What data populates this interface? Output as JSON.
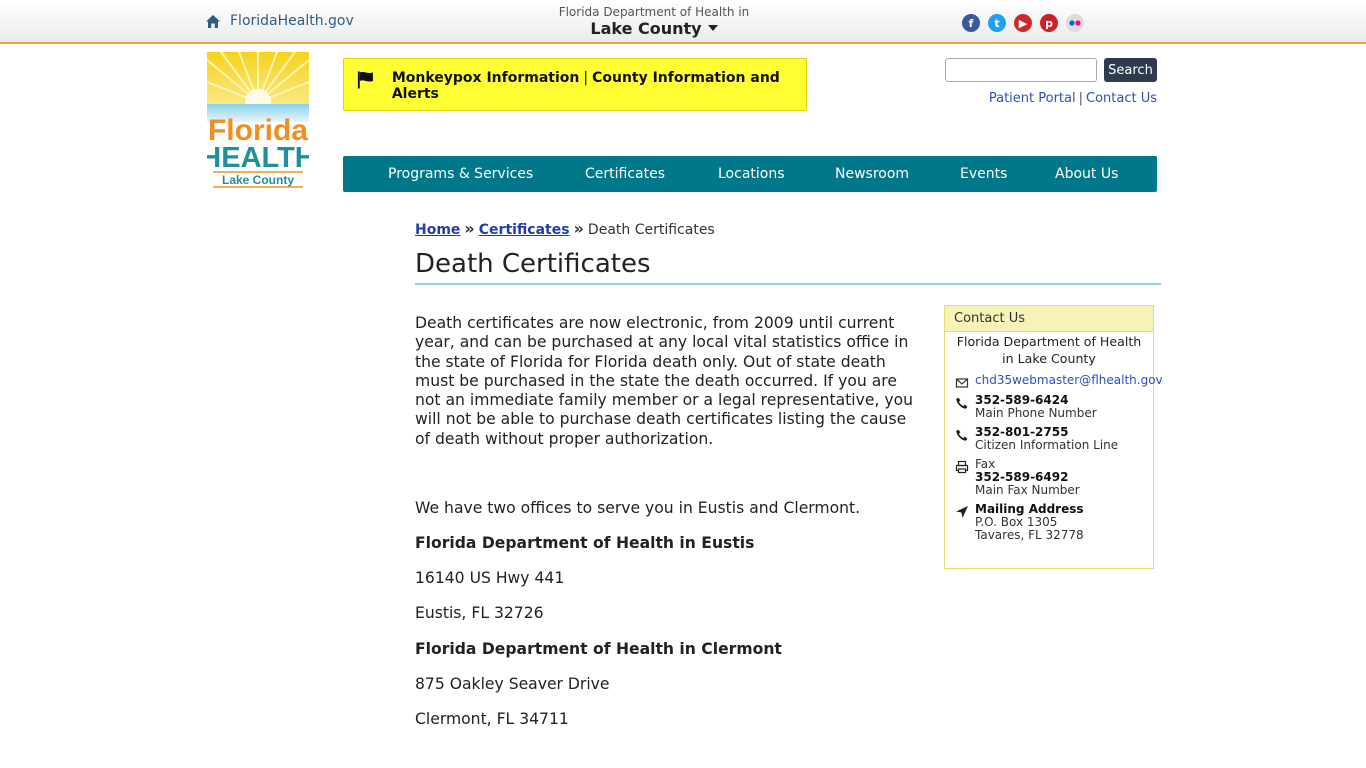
{
  "topbar": {
    "home_link": "FloridaHealth.gov",
    "dept_line": "Florida Department of Health in",
    "county": "Lake County",
    "social_icons": [
      "facebook-icon",
      "twitter-icon",
      "youtube-icon",
      "pinterest-icon",
      "flickr-icon"
    ]
  },
  "logo": {
    "word1": "Florida",
    "word2": "HEALTH",
    "county": "Lake County"
  },
  "alert": {
    "link1": "Monkeypox Information",
    "separator": "|",
    "link2": "County Information and Alerts"
  },
  "search": {
    "placeholder": "",
    "button": "Search"
  },
  "util_links": {
    "patient_portal": "Patient Portal",
    "separator": "|",
    "contact_us": "Contact Us"
  },
  "nav": {
    "items": [
      "Programs & Services",
      "Certificates",
      "Locations",
      "Newsroom",
      "Events",
      "About Us"
    ]
  },
  "breadcrumb": {
    "home": "Home",
    "separator": "»",
    "certificates": "Certificates",
    "current": "Death Certificates"
  },
  "page_title": "Death Certificates",
  "content": {
    "intro": "Death certificates are now electronic, from 2009 until current year, and can be purchased at any local vital statistics office in the state of Florida for Florida death only.  Out of state death must be purchased in the state the death occurred. If you are not an immediate family member or a legal representative, you will not be able to purchase death certificates listing the cause of death without proper authorization.",
    "offices_intro": "We have two offices to serve you in Eustis and Clermont.",
    "office1_name": "Florida Department of Health in Eustis",
    "office1_street": "16140 US Hwy 441",
    "office1_city": "Eustis, FL 32726",
    "office2_name": "Florida Department of Health in Clermont",
    "office2_street": "875 Oakley Seaver Drive",
    "office2_city": "Clermont, FL 34711"
  },
  "sidebar": {
    "heading": "Contact Us",
    "org": "Florida Department of Health in Lake County",
    "email": "chd35webmaster@flhealth.gov",
    "phone1": "352-589-6424",
    "phone1_label": "Main Phone Number",
    "phone2": "352-801-2755",
    "phone2_label": "Citizen Information Line",
    "fax_prefix": "Fax",
    "fax": "352-589-6492",
    "fax_label": "Main Fax Number",
    "mail_heading": "Mailing Address",
    "mail_line1": "P.O. Box 1305",
    "mail_line2": "Tavares, FL 32778"
  },
  "colors": {
    "nav_bg": "#00788a",
    "alert_bg": "#ffff33",
    "topbar_border": "#e8a33d",
    "link": "#2f4fb8",
    "sidebar_head_bg": "#f7f3b6"
  }
}
